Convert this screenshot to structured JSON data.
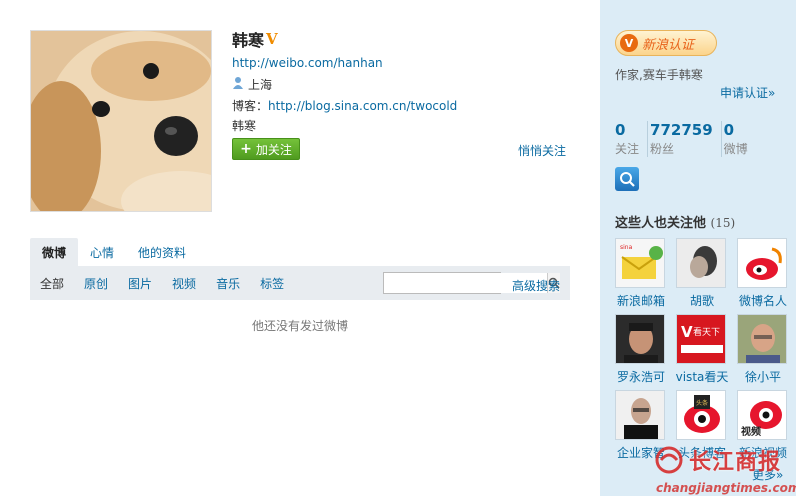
{
  "profile": {
    "name": "韩寒",
    "weibo_url": "http://weibo.com/hanhan",
    "location": "上海",
    "blog_label": "博客：",
    "blog_url": "http://blog.sina.com.cn/twocold",
    "bio": "韩寒",
    "follow_label": "加关注",
    "quiet_follow_label": "悄悄关注"
  },
  "tabs": [
    "微博",
    "心情",
    "他的资料"
  ],
  "filters": [
    "全部",
    "原创",
    "图片",
    "视频",
    "音乐",
    "标签"
  ],
  "search": {
    "value": "",
    "advanced_label": "高级搜索"
  },
  "empty_message": "他还没有发过微博",
  "sidebar": {
    "auth_label": "新浪认证",
    "auth_desc": "作家,赛车手韩寒",
    "apply_label": "申请认证»",
    "stats": [
      {
        "num": "0",
        "label": "关注"
      },
      {
        "num": "772759",
        "label": "粉丝"
      },
      {
        "num": "0",
        "label": "微博"
      }
    ],
    "also_follow_title": "这些人也关注他",
    "also_follow_count": "(15)",
    "people": [
      {
        "name": "新浪邮箱",
        "icon": "mail-logo"
      },
      {
        "name": "胡歌",
        "icon": "person-photo"
      },
      {
        "name": "微博名人",
        "icon": "weibo-logo"
      },
      {
        "name": "罗永浩可",
        "icon": "person-photo"
      },
      {
        "name": "vista看天",
        "icon": "vista-logo"
      },
      {
        "name": "徐小平",
        "icon": "person-photo"
      },
      {
        "name": "企业家智",
        "icon": "person-photo"
      },
      {
        "name": "头条博客",
        "icon": "eye-logo"
      },
      {
        "name": "新浪视频",
        "icon": "eye-logo"
      }
    ],
    "more_label": "更多»"
  },
  "watermark": {
    "logo_text": "长江商报",
    "url": "changjiangtimes.com"
  },
  "colors": {
    "link": "#0a6aa1",
    "sidebar_bg": "#dcecf6",
    "follow_green": "#5aa826",
    "auth_orange": "#e8621a"
  }
}
